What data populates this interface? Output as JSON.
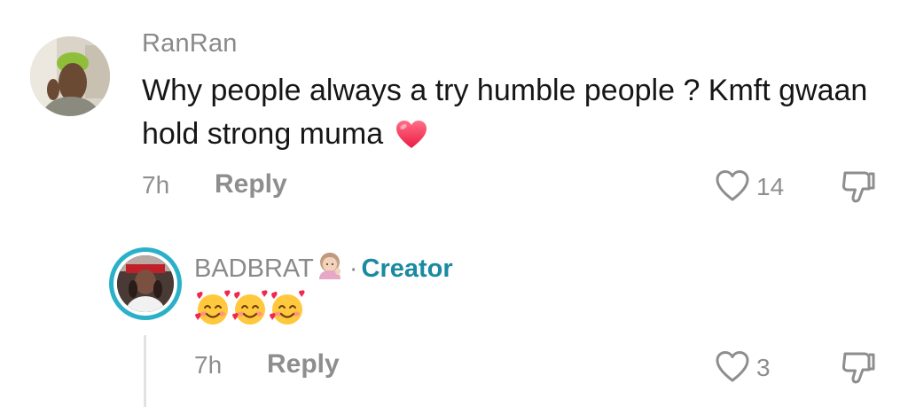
{
  "comment": {
    "username": "RanRan",
    "text": "Why people always a try humble people ? Kmft gwaan hold strong muma",
    "time": "7h",
    "reply_label": "Reply",
    "like_count": "14",
    "icons": {
      "heart_emoji": "red-heart-emoji",
      "like": "heart-outline-icon",
      "dislike": "thumbs-down-icon"
    }
  },
  "reply": {
    "username": "BADBRAT",
    "separator": "·",
    "badge": "Creator",
    "time": "7h",
    "reply_label": "Reply",
    "like_count": "3",
    "emoji_count": 3,
    "icons": {
      "name_emoji": "person-tipping-hand-emoji",
      "content_emoji": "smiling-face-with-hearts-emoji",
      "like": "heart-outline-icon",
      "dislike": "thumbs-down-icon"
    }
  },
  "colors": {
    "username_gray": "#8a8a8a",
    "meta_gray": "#8e8e8e",
    "creator_teal": "#1a8aa2",
    "avatar_ring": "#2bb0c9",
    "heart_red": "#f02a4f"
  }
}
